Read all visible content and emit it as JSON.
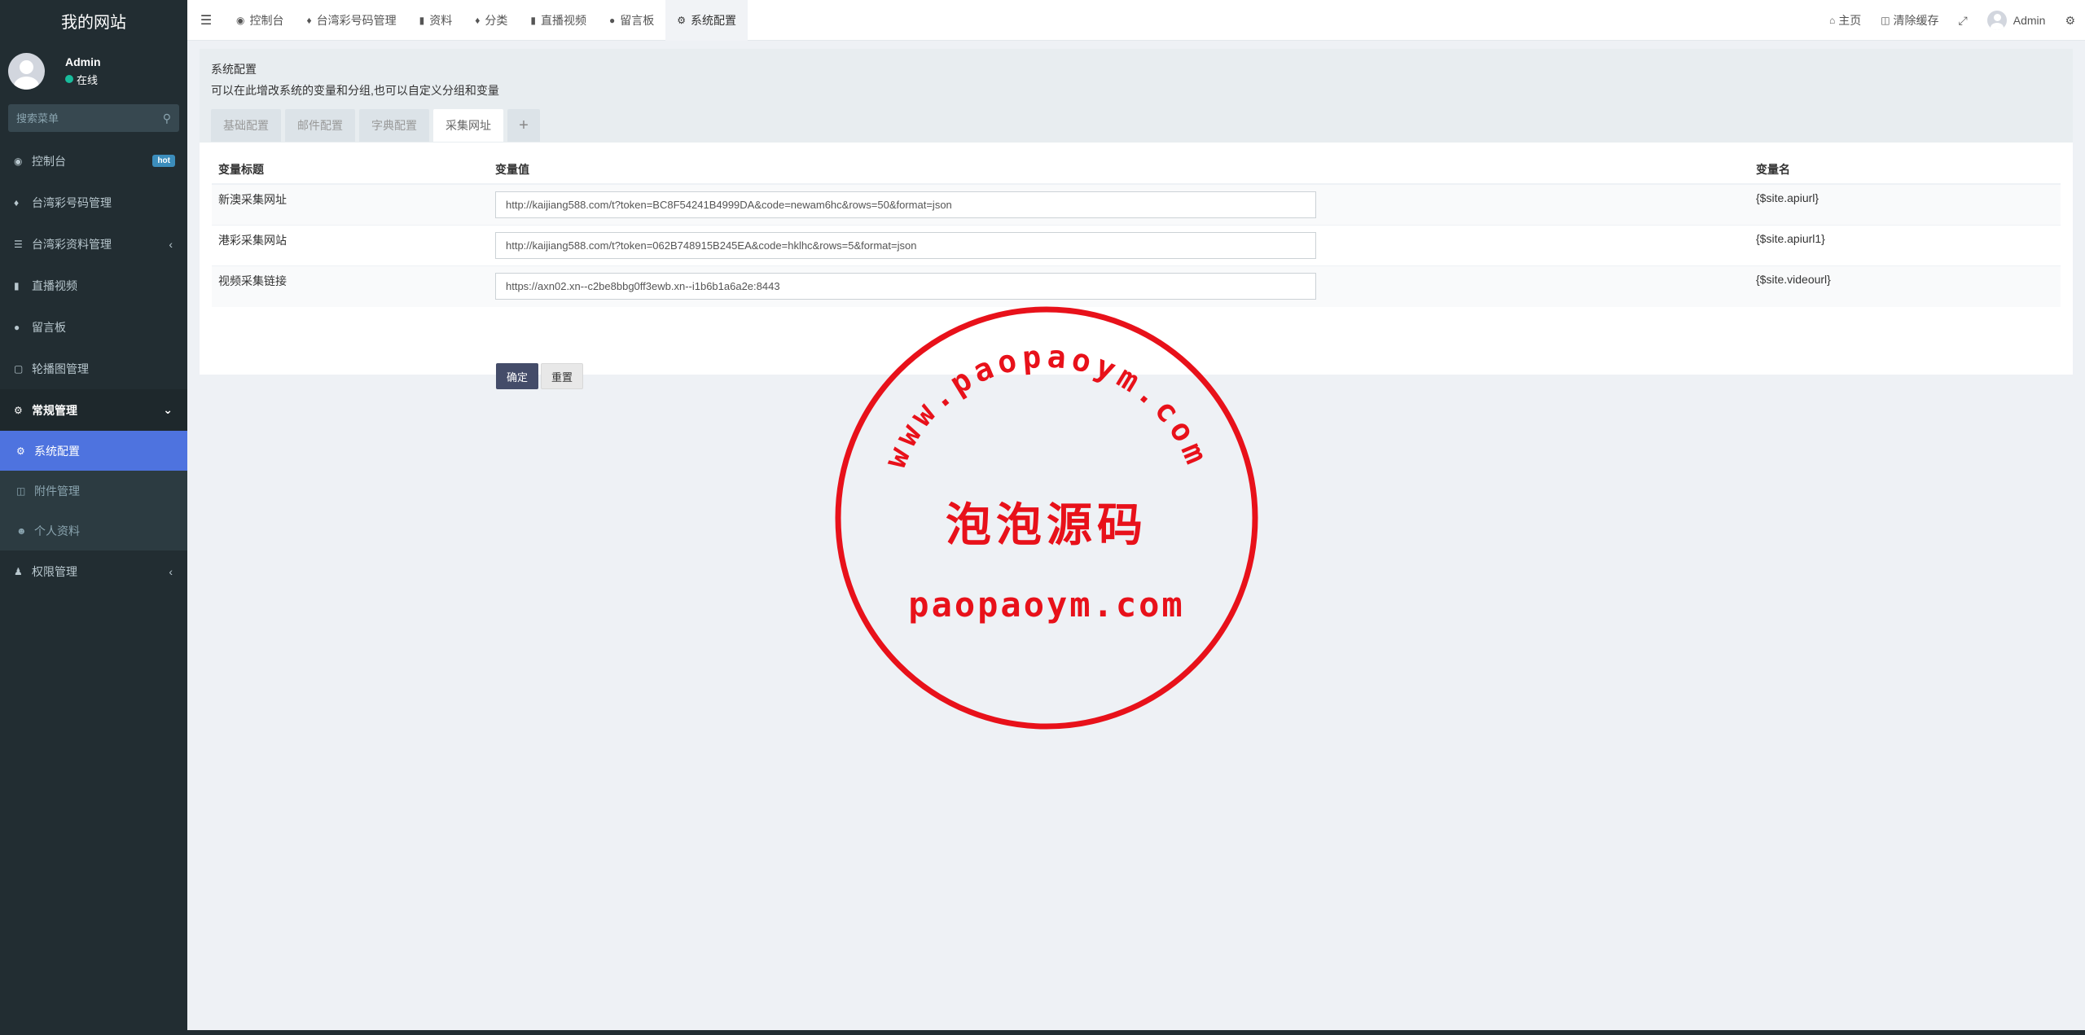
{
  "sidebar": {
    "logo": "我的网站",
    "user": {
      "name": "Admin",
      "status": "在线"
    },
    "search_placeholder": "搜索菜单",
    "menu": [
      {
        "label": "控制台",
        "badge": "hot"
      },
      {
        "label": "台湾彩号码管理"
      },
      {
        "label": "台湾彩资料管理"
      },
      {
        "label": "直播视频"
      },
      {
        "label": "留言板"
      },
      {
        "label": "轮播图管理"
      },
      {
        "label": "常规管理"
      }
    ],
    "submenu": [
      {
        "label": "系统配置"
      },
      {
        "label": "附件管理"
      },
      {
        "label": "个人资料"
      }
    ],
    "menu_after": [
      {
        "label": "权限管理"
      }
    ]
  },
  "navbar": {
    "tabs": [
      {
        "label": "控制台"
      },
      {
        "label": "台湾彩号码管理"
      },
      {
        "label": "资料"
      },
      {
        "label": "分类"
      },
      {
        "label": "直播视频"
      },
      {
        "label": "留言板"
      },
      {
        "label": "系统配置"
      }
    ],
    "right": {
      "home": "主页",
      "clear_cache": "清除缓存",
      "user": "Admin"
    }
  },
  "config": {
    "title": "系统配置",
    "description": "可以在此增改系统的变量和分组,也可以自定义分组和变量",
    "tabs": [
      {
        "label": "基础配置"
      },
      {
        "label": "邮件配置"
      },
      {
        "label": "字典配置"
      },
      {
        "label": "采集网址"
      }
    ],
    "add_tab": "+",
    "table": {
      "headers": [
        "变量标题",
        "变量值",
        "变量名"
      ],
      "rows": [
        {
          "title": "新澳采集网址",
          "value": "http://kaijiang588.com/t?token=BC8F54241B4999DA&code=newam6hc&rows=50&format=json",
          "name": "{$site.apiurl}"
        },
        {
          "title": "港彩采集网站",
          "value": "http://kaijiang588.com/t?token=062B748915B245EA&code=hklhc&rows=5&format=json",
          "name": "{$site.apiurl1}"
        },
        {
          "title": "视频采集链接",
          "value": "https://axn02.xn--c2be8bbg0ff3ewb.xn--i1b6b1a6a2e:8443",
          "name": "{$site.videourl}"
        }
      ]
    },
    "buttons": {
      "submit": "确定",
      "reset": "重置"
    }
  },
  "stamp": {
    "arc_text": "www.paopaoym.com",
    "center_text": "泡泡源码",
    "bottom_text": "paopaoym.com",
    "color": "#e8111a"
  }
}
